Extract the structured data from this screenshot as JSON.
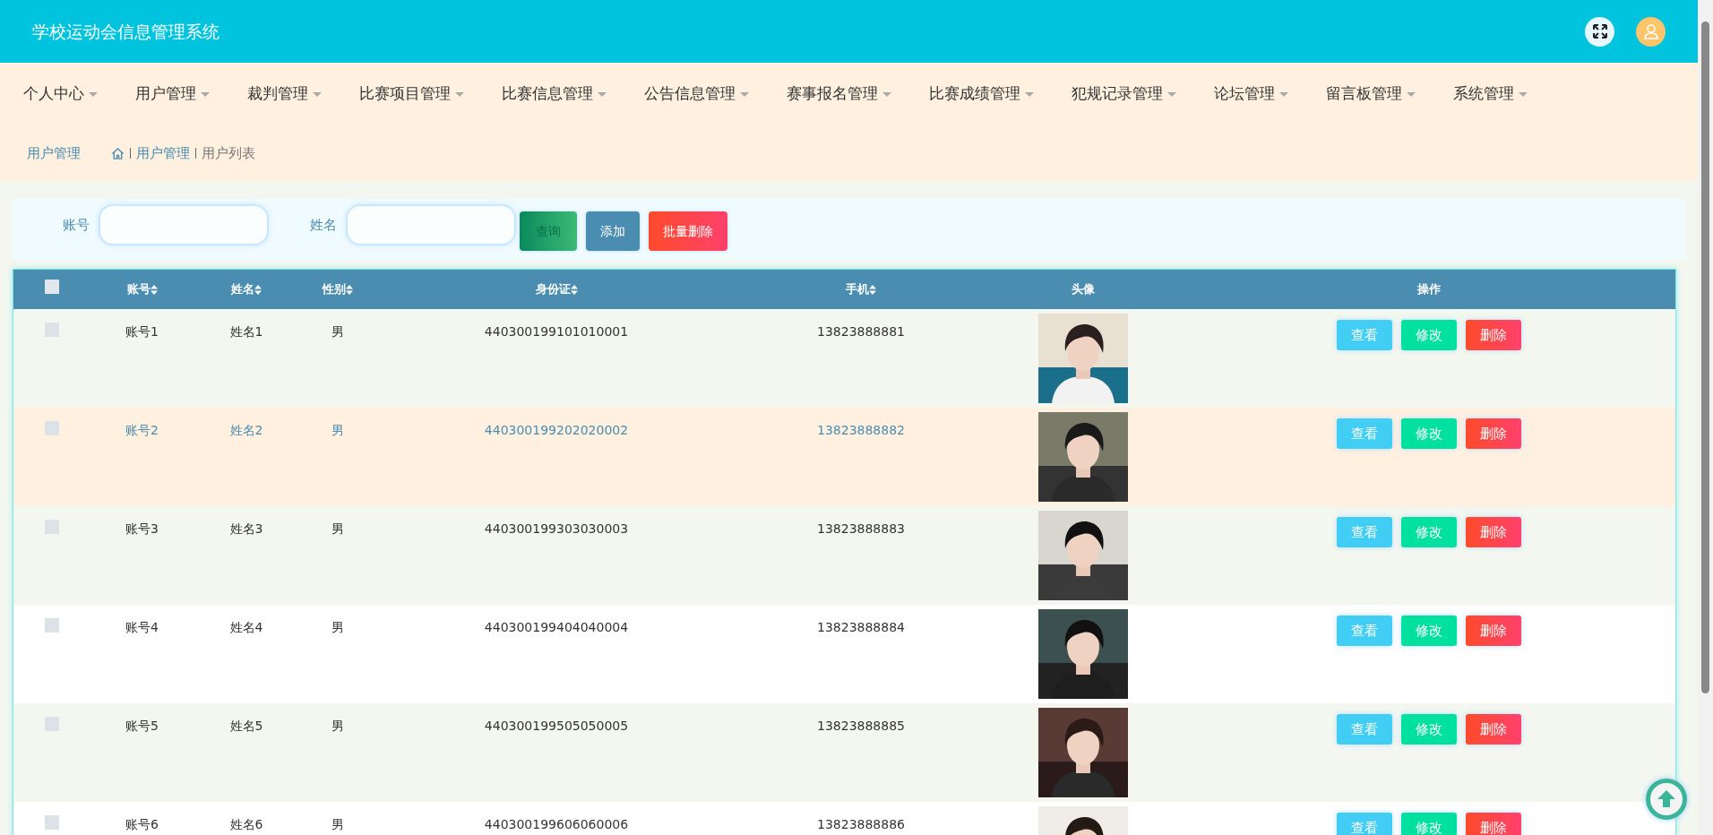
{
  "header": {
    "title": "学校运动会信息管理系统"
  },
  "nav": [
    {
      "label": "个人中心"
    },
    {
      "label": "用户管理"
    },
    {
      "label": "裁判管理"
    },
    {
      "label": "比赛项目管理"
    },
    {
      "label": "比赛信息管理"
    },
    {
      "label": "公告信息管理"
    },
    {
      "label": "赛事报名管理"
    },
    {
      "label": "比赛成绩管理"
    },
    {
      "label": "犯规记录管理"
    },
    {
      "label": "论坛管理"
    },
    {
      "label": "留言板管理"
    },
    {
      "label": "系统管理"
    }
  ],
  "breadcrumb": {
    "title": "用户管理",
    "path": [
      "用户管理",
      "用户列表"
    ]
  },
  "search": {
    "fields": [
      {
        "label": "账号"
      },
      {
        "label": "姓名"
      }
    ],
    "buttons": [
      {
        "label": "查询",
        "kind": "search"
      },
      {
        "label": "添加",
        "kind": "add"
      },
      {
        "label": "批量删除",
        "kind": "delete"
      }
    ]
  },
  "table": {
    "select_all": {
      "checked": false
    },
    "columns": [
      {
        "label": "账号",
        "sortable": true
      },
      {
        "label": "姓名",
        "sortable": true
      },
      {
        "label": "性别",
        "sortable": true
      },
      {
        "label": "身份证",
        "sortable": true
      },
      {
        "label": "手机",
        "sortable": true
      },
      {
        "label": "头像",
        "sortable": false
      },
      {
        "label": "操作",
        "sortable": false
      }
    ],
    "rows": [
      {
        "checked": false,
        "hovered": false,
        "account": "账号1",
        "name": "姓名1",
        "gender": "男",
        "id_card": "440300199101010001",
        "phone": "13823888881",
        "actions": [
          {
            "label": "查看",
            "kind": "view"
          },
          {
            "label": "修改",
            "kind": "edit"
          },
          {
            "label": "删除",
            "kind": "delete"
          }
        ]
      },
      {
        "checked": false,
        "hovered": true,
        "account": "账号2",
        "name": "姓名2",
        "gender": "男",
        "id_card": "440300199202020002",
        "phone": "13823888882",
        "actions": [
          {
            "label": "查看",
            "kind": "view"
          },
          {
            "label": "修改",
            "kind": "edit"
          },
          {
            "label": "删除",
            "kind": "delete"
          }
        ]
      },
      {
        "checked": false,
        "hovered": false,
        "account": "账号3",
        "name": "姓名3",
        "gender": "男",
        "id_card": "440300199303030003",
        "phone": "13823888883",
        "actions": [
          {
            "label": "查看",
            "kind": "view"
          },
          {
            "label": "修改",
            "kind": "edit"
          },
          {
            "label": "删除",
            "kind": "delete"
          }
        ]
      },
      {
        "checked": false,
        "hovered": false,
        "account": "账号4",
        "name": "姓名4",
        "gender": "男",
        "id_card": "440300199404040004",
        "phone": "13823888884",
        "actions": [
          {
            "label": "查看",
            "kind": "view"
          },
          {
            "label": "修改",
            "kind": "edit"
          },
          {
            "label": "删除",
            "kind": "delete"
          }
        ]
      },
      {
        "checked": false,
        "hovered": false,
        "account": "账号5",
        "name": "姓名5",
        "gender": "男",
        "id_card": "440300199505050005",
        "phone": "13823888885",
        "actions": [
          {
            "label": "查看",
            "kind": "view"
          },
          {
            "label": "修改",
            "kind": "edit"
          },
          {
            "label": "删除",
            "kind": "delete"
          }
        ]
      },
      {
        "checked": false,
        "hovered": false,
        "account": "账号6",
        "name": "姓名6",
        "gender": "男",
        "id_card": "440300199606060006",
        "phone": "13823888886",
        "actions": [
          {
            "label": "查看",
            "kind": "view"
          },
          {
            "label": "修改",
            "kind": "edit"
          },
          {
            "label": "删除",
            "kind": "delete"
          }
        ]
      }
    ]
  }
}
